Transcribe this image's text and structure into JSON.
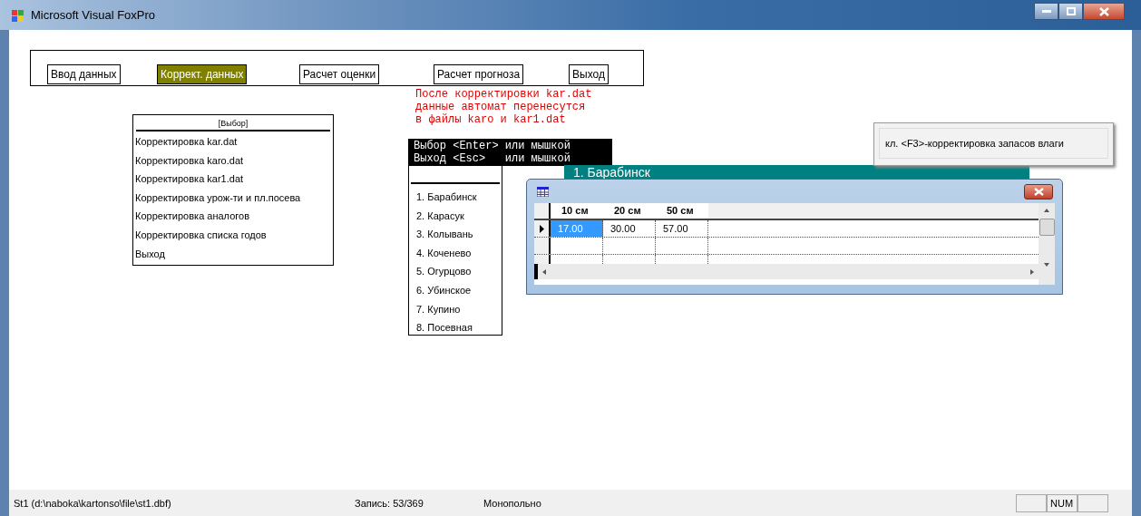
{
  "window": {
    "title": "Microsoft Visual FoxPro"
  },
  "menu": [
    {
      "label": "Ввод данных",
      "selected": false
    },
    {
      "label": "Коррект. данных",
      "selected": true
    },
    {
      "label": "Расчет оценки",
      "selected": false
    },
    {
      "label": "Расчет прогноза",
      "selected": false
    },
    {
      "label": "Выход",
      "selected": false
    }
  ],
  "note": [
    "После корректировки kar.dat",
    "данные автомат перенесутся",
    "в файлы karo и kar1.dat"
  ],
  "choice_popup": {
    "title": "[Выбор]",
    "items": [
      "Корректировка kar.dat",
      "Корректировка karo.dat",
      "Корректировка kar1.dat",
      "Корректировка урож-ти и пл.посева",
      "Корректировка аналогов",
      "Корректировка списка годов",
      "Выход"
    ]
  },
  "hints": [
    "Выбор <Enter> или мышкой",
    "Выход <Esc>   или мышкой"
  ],
  "stations": [
    "1. Барабинск",
    "2. Карасук",
    "3. Колывань",
    "4. Коченево",
    "5. Огурцово",
    "6. Убинское",
    "7. Купино",
    "8. Посевная"
  ],
  "station_header": "1. Барабинск",
  "grid": {
    "columns": [
      "10 см",
      "20 см",
      "50 см"
    ],
    "rows": [
      {
        "current": true,
        "cells": [
          {
            "value": "17.00",
            "selected": true
          },
          {
            "value": "30.00",
            "selected": false
          },
          {
            "value": "57.00",
            "selected": false
          }
        ]
      }
    ]
  },
  "tooltip": "кл. <F3>-корректировка запасов влаги",
  "status_bar": {
    "file": "St1 (d:\\naboka\\kartonso\\file\\st1.dbf)",
    "record": "Запись: 53/369",
    "mode": "Монопольно",
    "num": "NUM"
  }
}
